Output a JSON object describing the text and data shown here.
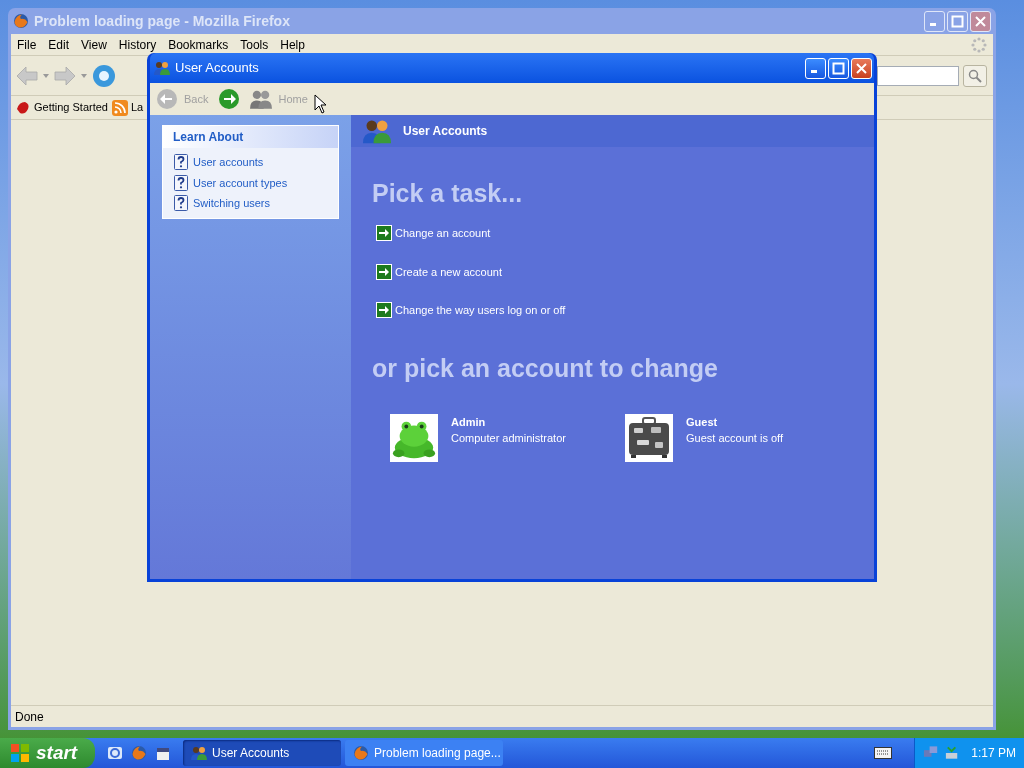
{
  "firefox": {
    "title": "Problem loading page - Mozilla Firefox",
    "menu": [
      "File",
      "Edit",
      "View",
      "History",
      "Bookmarks",
      "Tools",
      "Help"
    ],
    "bookmarks": [
      {
        "label": "Getting Started",
        "kind": "page"
      },
      {
        "label": "La",
        "kind": "feed"
      }
    ],
    "status": "Done"
  },
  "dialog": {
    "title": "User Accounts",
    "toolbar": [
      {
        "kind": "back",
        "label": "Back",
        "disabled": true
      },
      {
        "kind": "forward",
        "disabled": false
      },
      {
        "kind": "home",
        "label": "Home",
        "disabled": true
      }
    ],
    "learn_about": {
      "title": "Learn About",
      "items": [
        "User accounts",
        "User account types",
        "Switching users"
      ]
    },
    "header": "User Accounts",
    "task_heading": "Pick a task...",
    "tasks": [
      "Change an account",
      "Create a new account",
      "Change the way users log on or off"
    ],
    "account_heading": "or pick an account to change",
    "accounts": [
      {
        "name": "Admin",
        "description": "Computer administrator",
        "kind": "picture"
      },
      {
        "name": "Guest",
        "description": "Guest account is off",
        "kind": "picture"
      }
    ]
  },
  "taskbar": {
    "start": "start",
    "buttons": [
      {
        "label": "User Accounts",
        "selected": true,
        "kind": "users"
      },
      {
        "label": "Problem loading page...",
        "selected": false,
        "kind": "browser"
      }
    ],
    "clock": "1:17 PM"
  }
}
